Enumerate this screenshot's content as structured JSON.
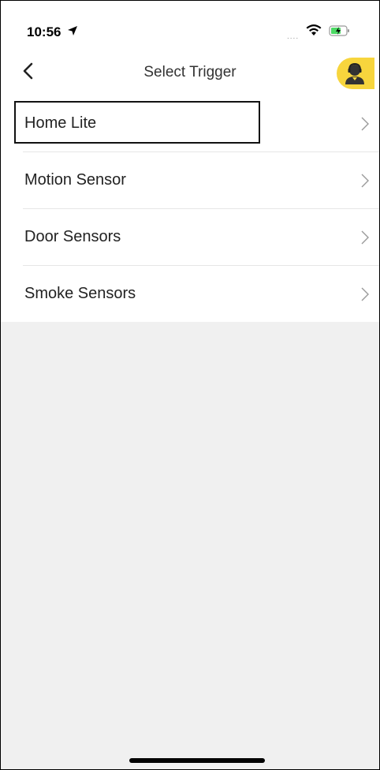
{
  "status_bar": {
    "time": "10:56",
    "signal_dots": "....",
    "icons": [
      "location-arrow-icon",
      "wifi-icon",
      "battery-charging-icon"
    ]
  },
  "nav": {
    "title": "Select Trigger",
    "back_icon": "chevron-left-icon",
    "avatar_icon": "support-agent-icon"
  },
  "colors": {
    "accent": "#f7d53d",
    "background": "#f0f0f0",
    "list_background": "#ffffff",
    "divider": "#e6e6e6"
  },
  "list": {
    "items": [
      {
        "label": "Home Lite"
      },
      {
        "label": "Motion Sensor"
      },
      {
        "label": "Door Sensors"
      },
      {
        "label": "Smoke Sensors"
      }
    ]
  }
}
